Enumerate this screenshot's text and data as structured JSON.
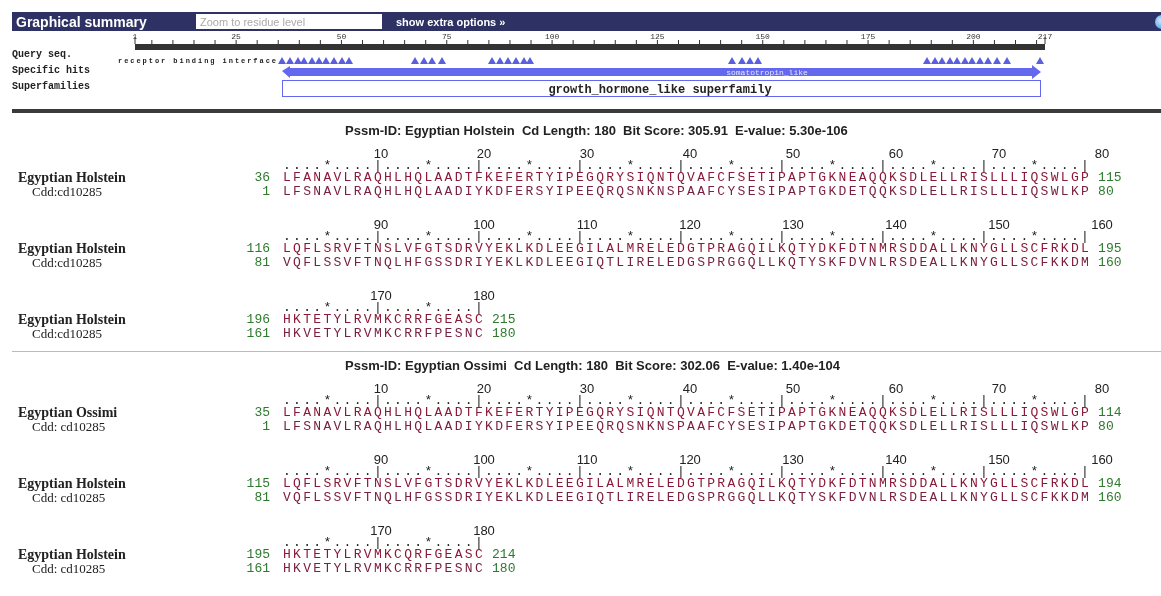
{
  "toolbar": {
    "title": "Graphical summary",
    "zoom_field": {
      "placeholder": "Zoom to residue level"
    },
    "options_link": "show extra options »"
  },
  "graphic": {
    "track_labels": [
      "Query seq.",
      "Specific hits",
      "Superfamilies"
    ],
    "ruler_ticks": [
      "1",
      "25",
      "50",
      "75",
      "100",
      "125",
      "150",
      "175",
      "200",
      "217"
    ],
    "feature_label": "receptor binding interface",
    "specific_hit": "somatotropin_like",
    "superfamily": "growth_hormone_like superfamily"
  },
  "alignments": [
    {
      "header": "Pssm-ID: Egyptian Holstein  Cd Length: 180  Bit Score: 305.91  E-value: 5.30e-106",
      "blocks": [
        {
          "ruler_labels": [
            "10",
            "20",
            "30",
            "40",
            "50",
            "60",
            "70",
            "80"
          ],
          "ruler_marks": "....*....|....*....|....*....|....*....|....*....|....*....|....*....|....*....|",
          "rows": [
            {
              "kind": "query",
              "name": "Egyptian Holstein",
              "start": "36",
              "sequence": "LFANAVLRAQHLHQLAADTFKEFERTYIPEGQRYSIQNTQVAFCFSETIPAPTGKNEAQQKSDLELLRISLLLIQSWLGP",
              "end": "115"
            },
            {
              "kind": "subject",
              "name": "Cdd:cd10285",
              "start": "1",
              "sequence": "LFSNAVLRAQHLHQLAADIYKDFERSYIPEEQRQSNKNSPAAFCYSESIPAPTGKDETQQKSDLELLRISLLLIQSWLKP",
              "end": "80"
            }
          ]
        },
        {
          "ruler_labels": [
            "90",
            "100",
            "110",
            "120",
            "130",
            "140",
            "150",
            "160"
          ],
          "ruler_marks": "....*....|....*....|....*....|....*....|....*....|....*....|....*....|....*....|",
          "rows": [
            {
              "kind": "query",
              "name": "Egyptian Holstein",
              "start": "116",
              "sequence": "LQFLSRVFTNSLVFGTSDRVYEKLKDLEEGILALMRELEDGTPRAGQILKQTYDKFDTNMRSDDALLKNYGLLSCFRKDL",
              "end": "195"
            },
            {
              "kind": "subject",
              "name": "Cdd:cd10285",
              "start": "81",
              "sequence": "VQFLSSVFTNQLHFGSSDRIYEKLKDLEEGIQTLIRELEDGSPRGGQLLKQTYSKFDVNLRSDEALLKNYGLLSCFKKDM",
              "end": "160"
            }
          ]
        },
        {
          "ruler_labels": [
            "170",
            "180"
          ],
          "ruler_marks": "....*....|....*....|",
          "rows": [
            {
              "kind": "query",
              "name": "Egyptian Holstein",
              "start": "196",
              "sequence": "HKTETYLRVMKCRRFGEASC",
              "end": "215"
            },
            {
              "kind": "subject",
              "name": "Cdd:cd10285",
              "start": "161",
              "sequence": "HKVETYLRVMKCRRFPESNC",
              "end": "180"
            }
          ]
        }
      ]
    },
    {
      "header": "Pssm-ID: Egyptian Ossimi  Cd Length: 180  Bit Score: 302.06  E-value: 1.40e-104",
      "blocks": [
        {
          "ruler_labels": [
            "10",
            "20",
            "30",
            "40",
            "50",
            "60",
            "70",
            "80"
          ],
          "ruler_marks": "....*....|....*....|....*....|....*....|....*....|....*....|....*....|....*....|",
          "rows": [
            {
              "kind": "query",
              "name": "Egyptian Ossimi",
              "start": "35",
              "sequence": "LFANAVLRAQHLHQLAADTFKEFERTYIPEGQRYSIQNTQVAFCFSETIPAPTGKNEAQQKSDLELLRISLLLIQSWLGP",
              "end": "114"
            },
            {
              "kind": "subject",
              "name": "Cdd: cd10285",
              "start": "1",
              "sequence": "LFSNAVLRAQHLHQLAADIYKDFERSYIPEEQRQSNKNSPAAFCYSESIPAPTGKDETQQKSDLELLRISLLLIQSWLKP",
              "end": "80"
            }
          ]
        },
        {
          "ruler_labels": [
            "90",
            "100",
            "110",
            "120",
            "130",
            "140",
            "150",
            "160"
          ],
          "ruler_marks": "....*....|....*....|....*....|....*....|....*....|....*....|....*....|....*....|",
          "rows": [
            {
              "kind": "query",
              "name": "Egyptian Holstein",
              "start": "115",
              "sequence": "LQFLSRVFTNSLVFGTSDRVYEKLKDLEEGILALMRELEDGTPRAGQILKQTYDKFDTNMRSDDALLKNYGLLSCFRKDL",
              "end": "194"
            },
            {
              "kind": "subject",
              "name": "Cdd: cd10285",
              "start": "81",
              "sequence": "VQFLSSVFTNQLHFGSSDRIYEKLKDLEEGIQTLIRELEDGSPRGGQLLKQTYSKFDVNLRSDEALLKNYGLLSCFKKDM",
              "end": "160"
            }
          ]
        },
        {
          "ruler_labels": [
            "170",
            "180"
          ],
          "ruler_marks": "....*....|....*....|",
          "rows": [
            {
              "kind": "query",
              "name": "Egyptian Holstein",
              "start": "195",
              "sequence": "HKTETYLRVMKCQRFGEASC",
              "end": "214"
            },
            {
              "kind": "subject",
              "name": "Cdd: cd10285",
              "start": "161",
              "sequence": "HKVETYLRVMKCRRFPESNC",
              "end": "180"
            }
          ]
        }
      ]
    }
  ]
}
